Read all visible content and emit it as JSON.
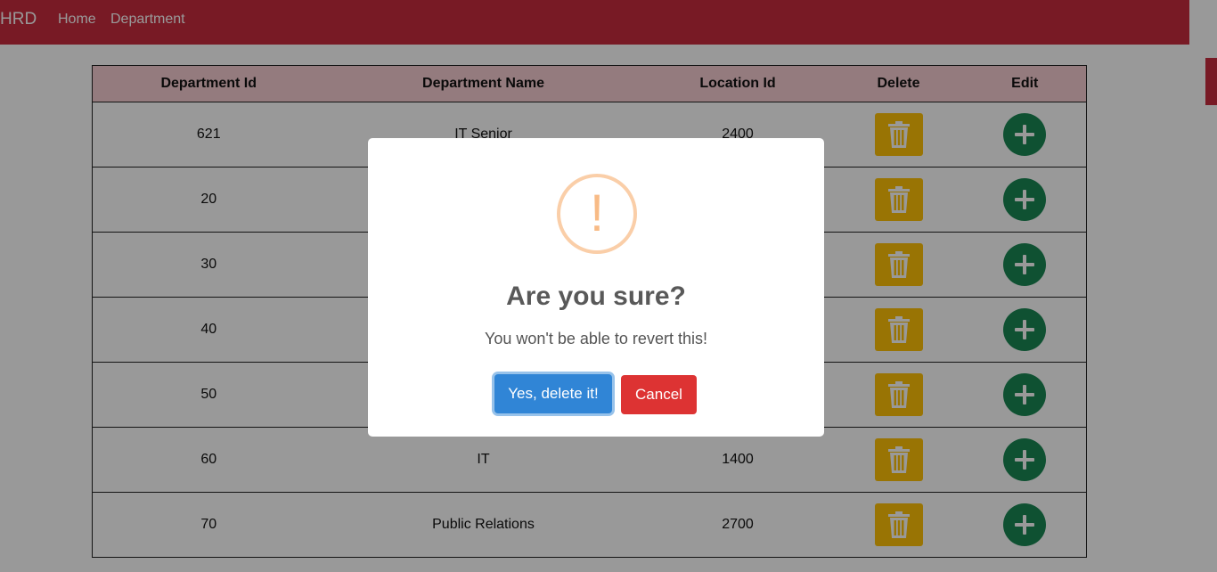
{
  "navbar": {
    "brand": "HRD",
    "links": [
      "Home",
      "Department"
    ]
  },
  "table": {
    "headers": [
      "Department Id",
      "Department Name",
      "Location Id",
      "Delete",
      "Edit"
    ],
    "rows": [
      {
        "id": "621",
        "name": "IT Senior",
        "location": "2400"
      },
      {
        "id": "20",
        "name": "",
        "location": ""
      },
      {
        "id": "30",
        "name": "",
        "location": ""
      },
      {
        "id": "40",
        "name": "",
        "location": ""
      },
      {
        "id": "50",
        "name": "",
        "location": ""
      },
      {
        "id": "60",
        "name": "IT",
        "location": "1400"
      },
      {
        "id": "70",
        "name": "Public Relations",
        "location": "2700"
      }
    ],
    "delete_icon": "trash-icon",
    "edit_icon": "plus-circle-icon"
  },
  "dialog": {
    "icon": "warning-icon",
    "icon_glyph": "!",
    "title": "Are you sure?",
    "text": "You won't be able to revert this!",
    "confirm_label": "Yes, delete it!",
    "cancel_label": "Cancel"
  },
  "colors": {
    "navbar": "#c82c3e",
    "delete_button": "#ffc107",
    "edit_button": "#1a8754",
    "confirm": "#3085d6",
    "cancel": "#dd3333",
    "warning": "#f8bb86"
  }
}
